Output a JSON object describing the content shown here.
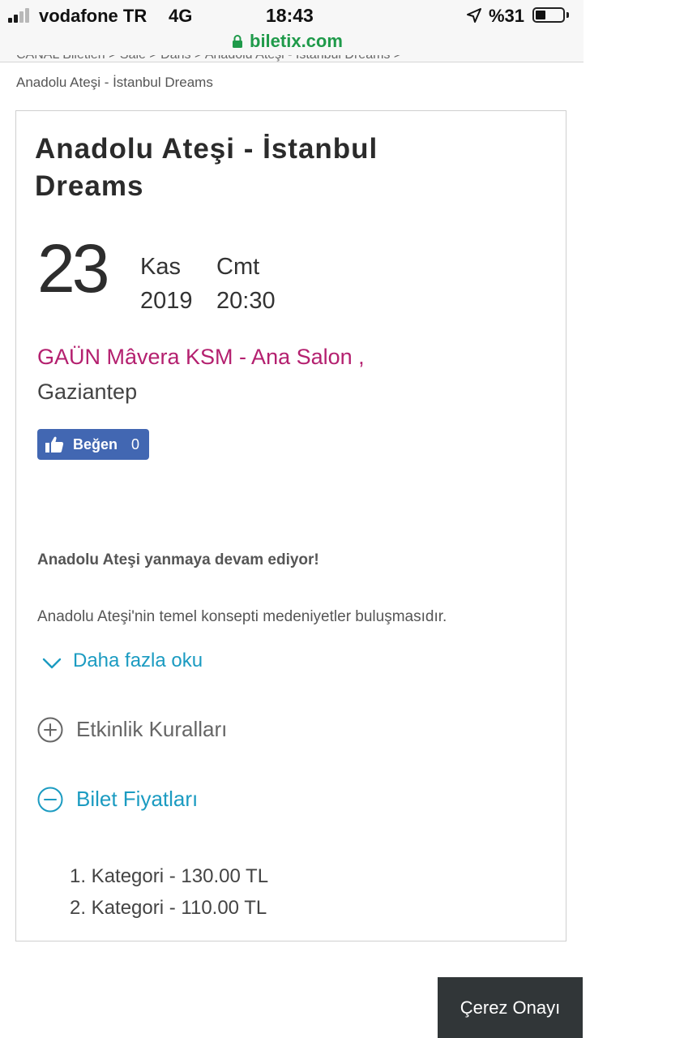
{
  "status_bar": {
    "carrier": "vodafone TR",
    "network": "4G",
    "time": "18:43",
    "battery": "%31",
    "battery_level_fraction": 0.31
  },
  "browser": {
    "url": "biletix.com"
  },
  "breadcrumb": {
    "partial_top": "CANAL Biletleri > Sale > Dans > Anadolu Ateşi - İstanbul Dreams >",
    "current": "Anadolu Ateşi - İstanbul Dreams"
  },
  "event": {
    "title": "Anadolu Ateşi - İstanbul Dreams",
    "day": "23",
    "month": "Kas",
    "weekday": "Cmt",
    "year": "2019",
    "time": "20:30",
    "venue": "GAÜN Mâvera KSM - Ana Salon ,",
    "city": "Gaziantep"
  },
  "like": {
    "label": "Beğen",
    "count": "0"
  },
  "description": {
    "headline": "Anadolu Ateşi yanmaya devam ediyor!",
    "text": "Anadolu Ateşi'nin temel konsepti medeniyetler buluşmasıdır.",
    "read_more": "Daha fazla oku"
  },
  "accordion": {
    "rules": "Etkinlik Kuralları",
    "prices": "Bilet Fiyatları"
  },
  "prices": [
    "1. Kategori - 130.00 TL",
    "2. Kategori - 110.00 TL"
  ],
  "cookie": {
    "label": "Çerez Onayı"
  },
  "colors": {
    "accent": "#1b9bc1",
    "venue": "#b4206f",
    "facebook": "#4267b2",
    "secure_url": "#1f9a4a",
    "cookie_bg": "#313638"
  }
}
